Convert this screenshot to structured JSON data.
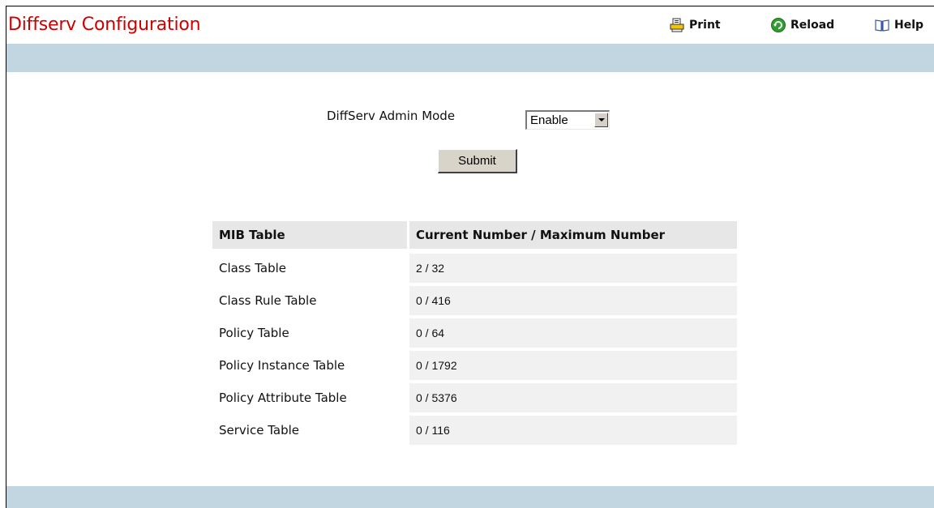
{
  "header": {
    "title": "Diffserv Configuration",
    "print_label": "Print",
    "reload_label": "Reload",
    "help_label": "Help"
  },
  "colors": {
    "title": "#cc0000",
    "band": "#c2d6e2",
    "header_cell": "#e7e7e7",
    "value_cell": "#f1f1f1"
  },
  "icons": {
    "print": "printer-icon",
    "reload": "reload-icon",
    "help": "book-icon"
  },
  "form": {
    "admin_mode_label": "DiffServ Admin Mode",
    "admin_mode_value": "Enable",
    "submit_label": "Submit"
  },
  "mib_table": {
    "headers": [
      "MIB Table",
      "Current Number / Maximum Number"
    ],
    "rows": [
      {
        "name": "Class Table",
        "value": "2 / 32"
      },
      {
        "name": "Class Rule Table",
        "value": "0 / 416"
      },
      {
        "name": "Policy Table",
        "value": "0 / 64"
      },
      {
        "name": "Policy Instance Table",
        "value": "0 / 1792"
      },
      {
        "name": "Policy Attribute Table",
        "value": "0 / 5376"
      },
      {
        "name": "Service Table",
        "value": "0 / 116"
      }
    ]
  }
}
